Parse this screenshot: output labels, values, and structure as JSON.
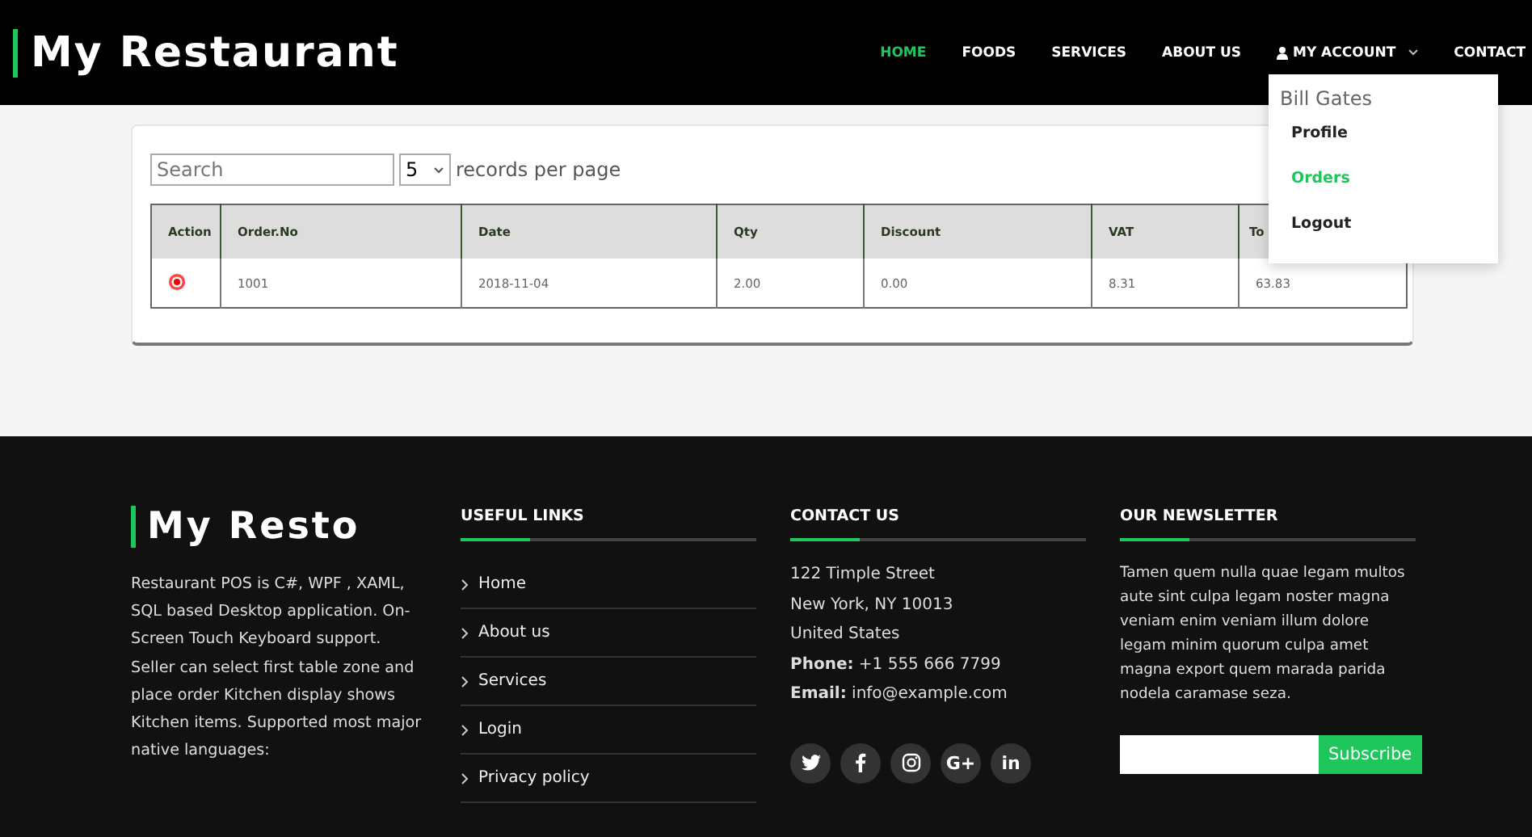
{
  "header": {
    "logo": "My Restaurant",
    "nav": [
      {
        "label": "HOME",
        "selected": true
      },
      {
        "label": "FOODS",
        "selected": false
      },
      {
        "label": "SERVICES",
        "selected": false
      },
      {
        "label": "ABOUT US",
        "selected": false
      },
      {
        "label": "MY ACCOUNT",
        "selected": false,
        "kind": "account"
      },
      {
        "label": "CONTACT",
        "selected": false
      }
    ]
  },
  "account_menu": {
    "user": "Bill Gates",
    "items": [
      {
        "label": "Profile",
        "selected": false
      },
      {
        "label": "Orders",
        "selected": true
      },
      {
        "label": "Logout",
        "selected": false
      }
    ]
  },
  "orders": {
    "search": {
      "placeholder": "Search"
    },
    "page_size": "5",
    "page_size_label": "records per page",
    "table": {
      "columns": [
        "Action",
        "Order.No",
        "Date",
        "Qty",
        "Discount",
        "VAT",
        "To"
      ],
      "rows": [
        {
          "cells": [
            "",
            "1001",
            "2018-11-04",
            "2.00",
            "0.00",
            "8.31",
            "63.83"
          ]
        }
      ]
    }
  },
  "footer": {
    "brand": "My Resto",
    "about": "Restaurant POS is C#, WPF , XAML, SQL based Desktop application. On-Screen Touch Keyboard support. Seller can select first table zone and place order Kitchen display shows Kitchen items. Supported most major native languages:",
    "useful_links": {
      "title": "USEFUL LINKS",
      "items": [
        "Home",
        "About us",
        "Services",
        "Login",
        "Privacy policy"
      ]
    },
    "contact": {
      "title": "CONTACT US",
      "lines": [
        {
          "text": "122 Timple Street"
        },
        {
          "text": "New York, NY 10013"
        },
        {
          "text": "United States"
        },
        {
          "label": "Phone:",
          "text": "+1 555 666 7799"
        },
        {
          "label": "Email:",
          "text": "info@example.com"
        }
      ],
      "social": [
        {
          "kind": "twitter"
        },
        {
          "kind": "facebook"
        },
        {
          "kind": "instagram"
        },
        {
          "kind": "glyph",
          "text": "G+"
        },
        {
          "kind": "glyph",
          "text": "in"
        }
      ]
    },
    "newsletter": {
      "title": "OUR NEWSLETTER",
      "text": "Tamen quem nulla quae legam multos aute sint culpa legam noster magna veniam enim veniam illum dolore legam minim quorum culpa amet magna export quem marada parida nodela caramase seza.",
      "button": "Subscribe"
    }
  }
}
